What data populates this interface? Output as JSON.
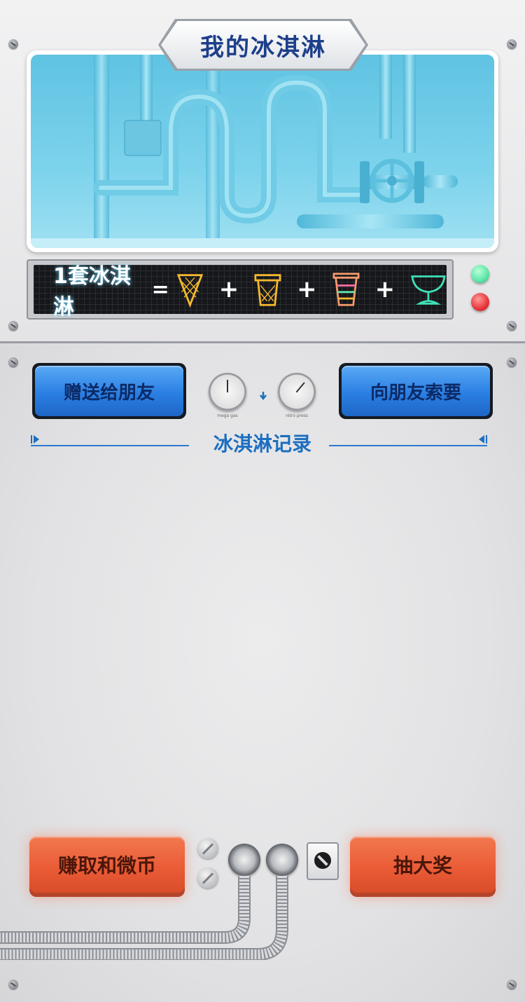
{
  "header": {
    "title": "我的冰淇淋"
  },
  "formula": {
    "lhs": "1套冰淇淋",
    "equals": "=",
    "plus": "+",
    "items": [
      "cone-icon",
      "cup-basket-icon",
      "striped-cup-icon",
      "glass-bowl-icon"
    ],
    "item_colors": [
      "#f5b92e",
      "#f5b92e",
      "#f59a6b",
      "#3fe0b8"
    ]
  },
  "indicators": {
    "green": "#5ee6a6",
    "red": "#e8343a"
  },
  "actions": {
    "gift_label": "赠送给朋友",
    "request_label": "向朋友索要"
  },
  "gauges": [
    {
      "label": "mega gas"
    },
    {
      "label": "nitro press"
    }
  ],
  "records": {
    "title": "冰淇淋记录"
  },
  "bottom": {
    "earn_label": "赚取和微币",
    "lottery_label": "抽大奖"
  }
}
